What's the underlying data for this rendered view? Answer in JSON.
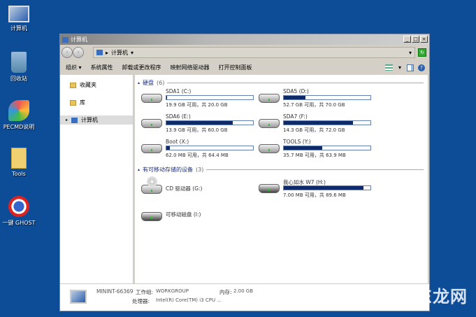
{
  "desktop": {
    "icons": [
      {
        "label": "计算机",
        "icon": "computer-icon"
      },
      {
        "label": "回收站",
        "icon": "recycle-bin-icon"
      },
      {
        "label": "PECMD说明",
        "icon": "pecmd-icon"
      },
      {
        "label": "Tools",
        "icon": "folder-icon"
      },
      {
        "label": "一键 GHOST",
        "icon": "ghost-icon"
      }
    ],
    "watermark": "广东龙网"
  },
  "window": {
    "title": "计算机",
    "controls": {
      "minimize": "_",
      "maximize": "□",
      "close": "×"
    },
    "address": {
      "path": "计算机"
    },
    "toolbar": {
      "organize": "组织 ▾",
      "system_properties": "系统属性",
      "uninstall": "卸载或更改程序",
      "map_drive": "映射网络驱动器",
      "control_panel": "打开控制面板"
    },
    "nav": [
      {
        "label": "收藏夹"
      },
      {
        "label": "库"
      },
      {
        "label": "计算机"
      }
    ],
    "groups": {
      "hdd": {
        "title": "硬盘",
        "count": "(6)"
      },
      "removable": {
        "title": "有可移动存储的设备",
        "count": "(3)"
      }
    },
    "drives": [
      {
        "name": "SDA1 (C:)",
        "info": "19.9 GB 可用，共 20.0 GB",
        "used": 0.005
      },
      {
        "name": "SDA5 (D:)",
        "info": "52.7 GB 可用，共 70.0 GB",
        "used": 0.25
      },
      {
        "name": "SDA6 (E:)",
        "info": "13.9 GB 可用，共 60.0 GB",
        "used": 0.77
      },
      {
        "name": "SDA7 (F:)",
        "info": "14.3 GB 可用，共 72.0 GB",
        "used": 0.8
      },
      {
        "name": "Boot (X:)",
        "info": "62.0 MB 可用，共 64.4 MB",
        "used": 0.04
      },
      {
        "name": "TOOLS (Y:)",
        "info": "35.7 MB 可用，共 63.9 MB",
        "used": 0.44
      }
    ],
    "removable": [
      {
        "name": "CD 驱动器 (G:)"
      },
      {
        "name": "我心如水 W7 (H:)",
        "info": "7.00 MB 可用，共 89.6 MB",
        "used": 0.92
      },
      {
        "name": "可移动磁盘 (I:)"
      }
    ],
    "status": {
      "computer": "MININT-66369",
      "workgroup_label": "工作组:",
      "workgroup": "WORKGROUP",
      "memory_label": "内存:",
      "memory": "2.00 GB",
      "cpu_label": "处理器:",
      "cpu": "Intel(R) Core(TM) i3 CPU ..."
    }
  }
}
